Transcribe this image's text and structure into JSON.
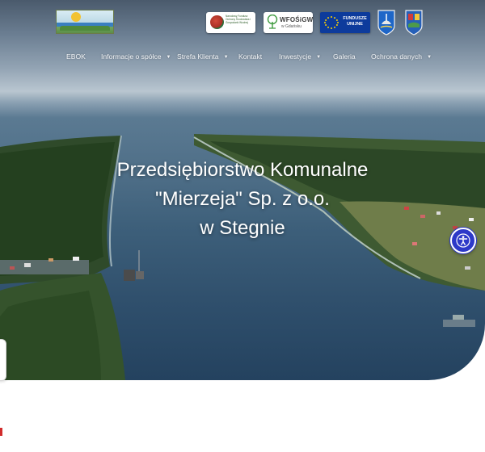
{
  "header": {
    "logo_icon": "mierzeja-logo",
    "partners": [
      {
        "name": "nfosigw-badge",
        "text": "Narodowy Fundusz Ochrony Środowiska i Gospodarki Wodnej"
      },
      {
        "name": "wfosigw-badge",
        "title": "WFOŚiGW",
        "subtitle": "w Gdańsku"
      },
      {
        "name": "eu-funds-badge",
        "text_line1": "FUNDUSZE",
        "text_line2": "UNIJNE"
      },
      {
        "name": "crest-1",
        "icon": "coat-of-arms-icon"
      },
      {
        "name": "crest-2",
        "icon": "coat-of-arms-icon"
      }
    ]
  },
  "nav": {
    "items": [
      {
        "label": "EBOK",
        "dropdown": false
      },
      {
        "label": "Informacje o spółce",
        "dropdown": true
      },
      {
        "label": "Strefa Klienta",
        "dropdown": true
      },
      {
        "label": "Kontakt",
        "dropdown": false
      },
      {
        "label": "Inwestycje",
        "dropdown": true
      },
      {
        "label": "Galeria",
        "dropdown": false
      },
      {
        "label": "Ochrona danych",
        "dropdown": true
      }
    ],
    "caret": "▼"
  },
  "hero": {
    "title_line1": "Przedsiębiorstwo Komunalne",
    "title_line2": "\"Mierzeja\" Sp. z o.o.",
    "title_line3": "w Stegnie"
  },
  "accessibility": {
    "icon": "accessibility-icon",
    "accent": "#2d39c8"
  },
  "colors": {
    "nav_text": "#f1f4f7",
    "eu_blue": "#0d3b9c"
  }
}
